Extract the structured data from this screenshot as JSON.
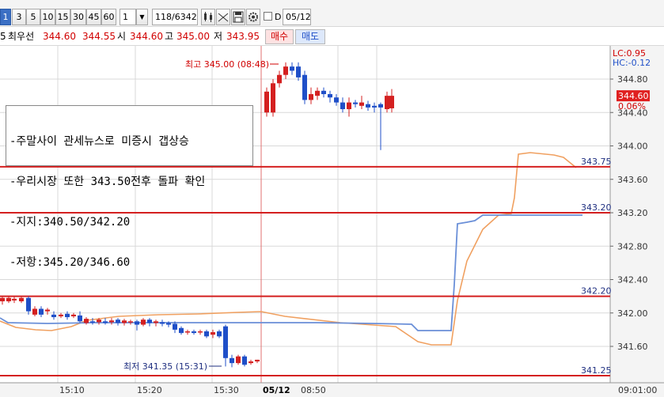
{
  "toolbar": {
    "tick_buttons": [
      "1",
      "3",
      "5",
      "10",
      "15",
      "30",
      "45",
      "60"
    ],
    "interval_value": "1",
    "dropdown_arrow": "▼",
    "count_display": "118/6342",
    "date_checkbox_label": "D",
    "date_value": "05/12"
  },
  "quote": {
    "prefix": "5",
    "best_label": "최우선",
    "best_ask": "344.60",
    "best_bid": "344.55",
    "open_label": "시",
    "open_value": "344.60",
    "high_label": "고",
    "high_value": "345.00",
    "low_label": "저",
    "low_value": "343.95",
    "buy_label": "매수",
    "sell_label": "매도"
  },
  "chart": {
    "lc_label": "LC:0.95",
    "hc_label": "HC:-0.12",
    "current_price": "344.60",
    "current_change": "0.06%",
    "y_ticks": [
      "344.80",
      "344.40",
      "344.00",
      "343.60",
      "343.20",
      "342.80",
      "342.40",
      "342.00",
      "341.60"
    ],
    "x_ticks": [
      "15:10",
      "15:20",
      "15:30",
      "05/12",
      "08:50",
      "09:01:00"
    ],
    "hlines": [
      "343.75",
      "343.20",
      "342.20",
      "341.25"
    ],
    "high_marker": "최고 345.00 (08:48)",
    "low_marker": "최저 341.35 (15:31)",
    "annotation": [
      "-주말사이 관세뉴스로 미증시 갭상승",
      "-우리시장 또한 343.50전후 돌파 확인",
      "-지지:340.50/342.20",
      "-저항:345.20/346.60"
    ]
  },
  "colors": {
    "up": "#d42020",
    "down": "#1f4fc8",
    "hline": "#d42020",
    "orange_line": "#f0a060",
    "blue_line": "#6a8fd8",
    "price_box": "#e02020"
  }
}
